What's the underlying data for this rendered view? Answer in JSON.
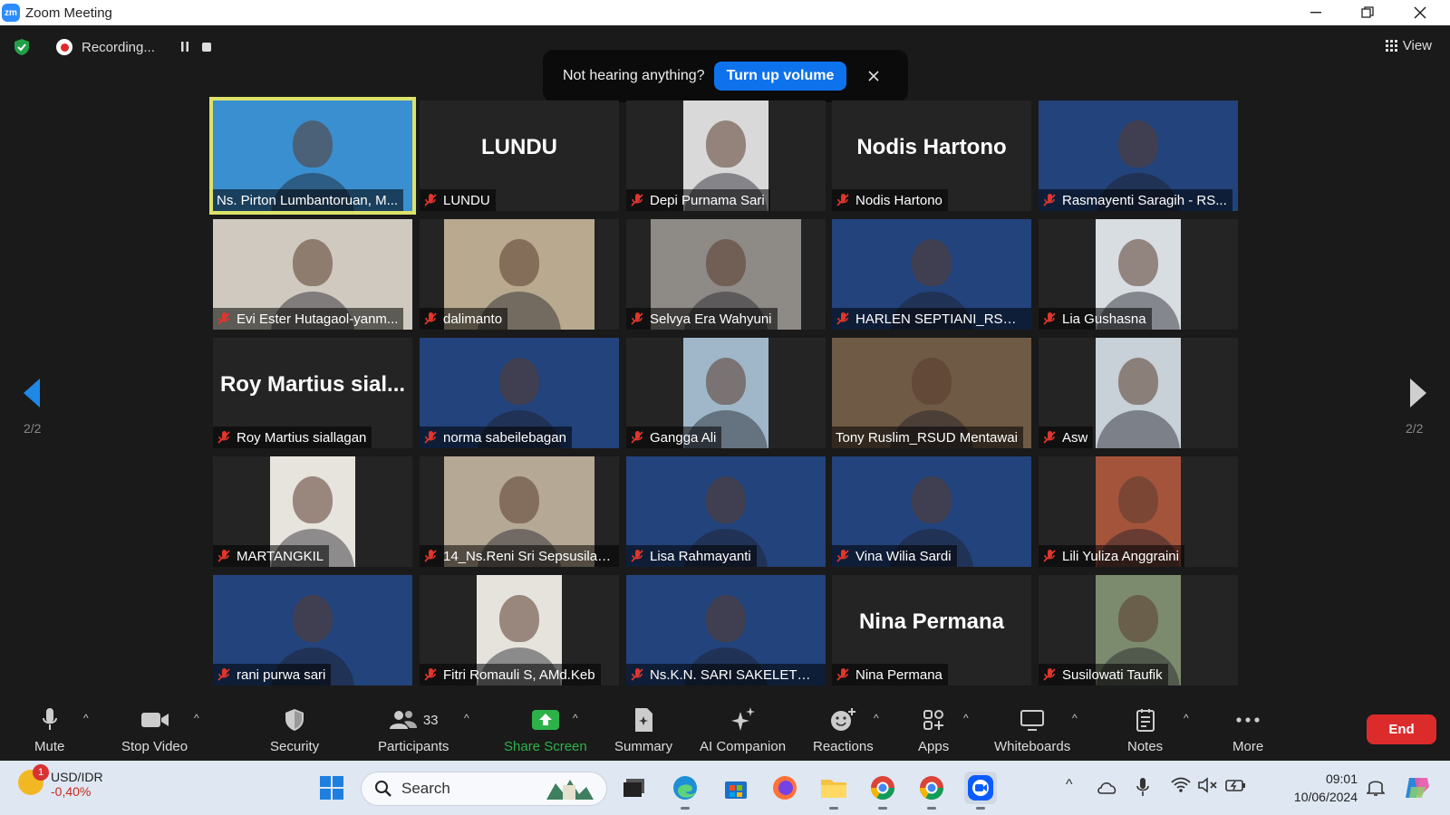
{
  "window": {
    "title": "Zoom Meeting",
    "app_icon": "zm"
  },
  "recording": {
    "label": "Recording..."
  },
  "view": {
    "label": "View"
  },
  "toast": {
    "message": "Not hearing anything?",
    "button": "Turn up volume"
  },
  "pager": {
    "left": "2/2",
    "right": "2/2"
  },
  "participants": [
    {
      "name": "Ns. Pirton Lumbantoruan, M...",
      "big": "",
      "video": "#3a8fd0",
      "active": true,
      "muted": false
    },
    {
      "name": "LUNDU",
      "big": "LUNDU",
      "video": "",
      "active": false,
      "muted": true
    },
    {
      "name": "Depi Purnama Sari",
      "big": "",
      "video": "#d9d9d9",
      "active": false,
      "muted": true
    },
    {
      "name": "Nodis Hartono",
      "big": "Nodis Hartono",
      "video": "",
      "active": false,
      "muted": true
    },
    {
      "name": "Rasmayenti Saragih - RS...",
      "big": "",
      "video": "#22437c",
      "active": false,
      "muted": true
    },
    {
      "name": "Evi Ester Hutagaol-yanm...",
      "big": "",
      "video": "#cfc9bf",
      "active": false,
      "muted": true
    },
    {
      "name": "dalimanto",
      "big": "",
      "video": "#b9a98f",
      "active": false,
      "muted": true
    },
    {
      "name": "Selvya Era Wahyuni",
      "big": "",
      "video": "#8e8a86",
      "active": false,
      "muted": true
    },
    {
      "name": "HARLEN SEPTIANI_RSUD...",
      "big": "",
      "video": "#22437c",
      "active": false,
      "muted": true
    },
    {
      "name": "Lia Gushasna",
      "big": "",
      "video": "#d8dde2",
      "active": false,
      "muted": true
    },
    {
      "name": "Roy Martius siallagan",
      "big": "Roy Martius sial...",
      "video": "",
      "active": false,
      "muted": true
    },
    {
      "name": "norma sabeilebagan",
      "big": "",
      "video": "#22437c",
      "active": false,
      "muted": true
    },
    {
      "name": "Gangga Ali",
      "big": "",
      "video": "#9fb7c9",
      "active": false,
      "muted": true
    },
    {
      "name": "Tony Ruslim_RSUD Mentawai",
      "big": "",
      "video": "#6f5a45",
      "active": false,
      "muted": false
    },
    {
      "name": "Asw",
      "big": "",
      "video": "#c8d0d8",
      "active": false,
      "muted": true
    },
    {
      "name": "MARTANGKIL",
      "big": "",
      "video": "#e7e3dd",
      "active": false,
      "muted": true
    },
    {
      "name": "14_Ns.Reni Sri Sepsusilaw...",
      "big": "",
      "video": "#b5a895",
      "active": false,
      "muted": true
    },
    {
      "name": "Lisa Rahmayanti",
      "big": "",
      "video": "#22437c",
      "active": false,
      "muted": true
    },
    {
      "name": "Vina Wilia Sardi",
      "big": "",
      "video": "#22437c",
      "active": false,
      "muted": true
    },
    {
      "name": "Lili Yuliza Anggraini",
      "big": "",
      "video": "#a5543c",
      "active": false,
      "muted": true
    },
    {
      "name": "rani purwa sari",
      "big": "",
      "video": "#22437c",
      "active": false,
      "muted": true
    },
    {
      "name": "Fitri Romauli S, AMd.Keb",
      "big": "",
      "video": "#e6e3dd",
      "active": false,
      "muted": true
    },
    {
      "name": "Ns.K.N. SARI SAKELETUN...",
      "big": "",
      "video": "#22437c",
      "active": false,
      "muted": true
    },
    {
      "name": "Nina Permana",
      "big": "Nina Permana",
      "video": "",
      "active": false,
      "muted": true
    },
    {
      "name": "Susilowati Taufik",
      "big": "",
      "video": "#7c8b6e",
      "active": false,
      "muted": true
    }
  ],
  "toolbar": {
    "mute": "Mute",
    "stop_video": "Stop Video",
    "security": "Security",
    "participants": "Participants",
    "participants_count": "33",
    "share_screen": "Share Screen",
    "summary": "Summary",
    "ai_companion": "AI Companion",
    "reactions": "Reactions",
    "apps": "Apps",
    "whiteboards": "Whiteboards",
    "notes": "Notes",
    "more": "More",
    "end": "End"
  },
  "taskbar": {
    "widget_title": "USD/IDR",
    "widget_change": "-0,40%",
    "widget_badge": "1",
    "search": "Search",
    "time": "09:01",
    "date": "10/06/2024"
  },
  "colors": {
    "accent": "#0e72ed",
    "share_green": "#2db24a",
    "end_red": "#dc2b2b",
    "active_outline": "#dde36a",
    "muted_red": "#e0362c"
  }
}
